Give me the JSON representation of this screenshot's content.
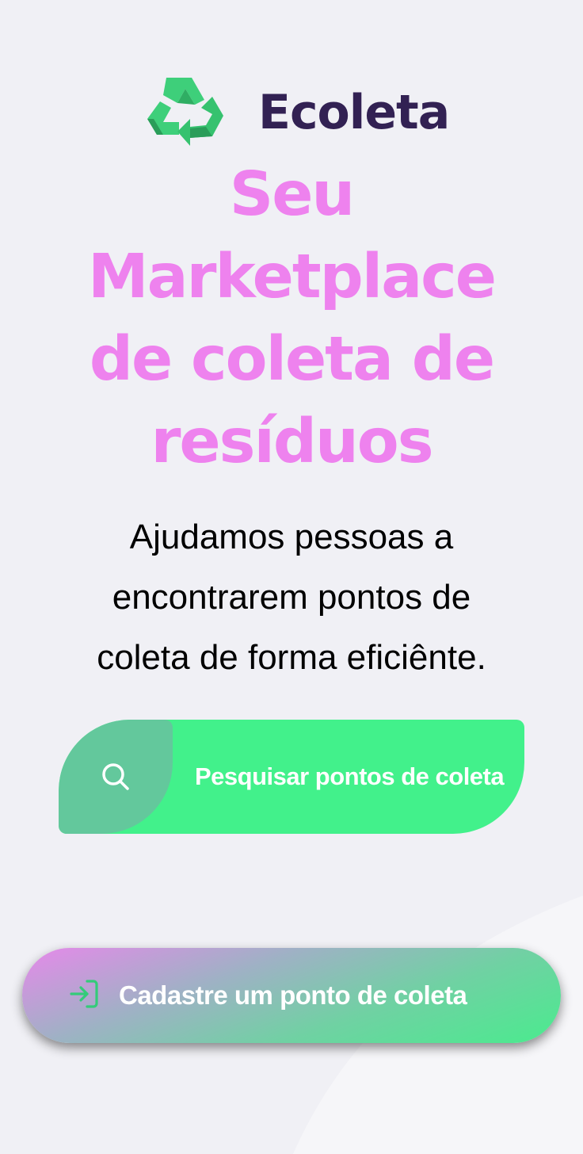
{
  "header": {
    "logo_icon": "recycle-icon",
    "app_name": "Ecoleta"
  },
  "hero": {
    "headline": "Seu Marketplace de coleta de resíduos",
    "subtitle": "Ajudamos pessoas a encontrarem pontos de coleta de forma eficiênte."
  },
  "search_button": {
    "icon": "search-icon",
    "label": "Pesquisar pontos de coleta"
  },
  "register_button": {
    "icon": "log-in-icon",
    "label": "Cadastre um ponto de coleta"
  },
  "colors": {
    "background": "#f0f0f5",
    "brand_dark": "#322153",
    "headline": "#ee82ee",
    "primary_green": "#42f18b",
    "icon_block_green": "#63c89c"
  }
}
